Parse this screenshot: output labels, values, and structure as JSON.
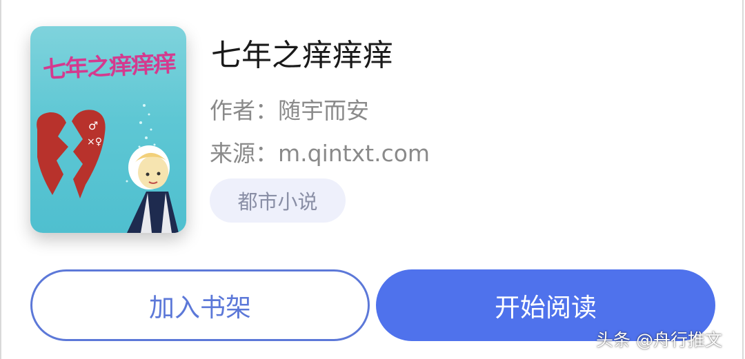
{
  "book": {
    "cover_title": "七年之痒痒痒",
    "title": "七年之痒痒痒",
    "author_line": "作者：随宇而安",
    "source_line": "来源：m.qintxt.com",
    "genre_tag": "都市小说"
  },
  "actions": {
    "add_to_shelf": "加入书架",
    "start_reading": "开始阅读"
  },
  "watermark": "头条 @舟行推文",
  "colors": {
    "primary": "#4f72ec",
    "outline": "#5c78d8",
    "tag_bg": "#eef0fb",
    "cover_title": "#d43a8e"
  }
}
